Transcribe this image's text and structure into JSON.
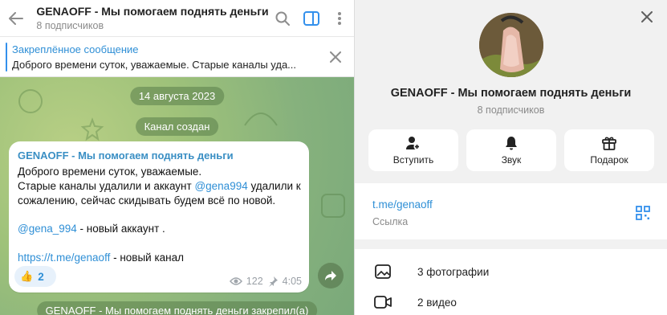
{
  "chat": {
    "title": "GENAOFF - Мы помогаем поднять деньги",
    "subtitle": "8 подписчиков",
    "pinned": {
      "title": "Закреплённое сообщение",
      "text": "Доброго времени суток, уважаемые.  Старые каналы уда..."
    },
    "date_label": "14 августа 2023",
    "created_label": "Канал создан",
    "message": {
      "author": "GENAOFF - Мы помогаем поднять деньги",
      "line1": "Доброго времени суток, уважаемые.",
      "line2_a": "Старые каналы удалили и аккаунт ",
      "line2_mention": "@gena994",
      "line2_b": " удалили к",
      "line3": "сожалению, сейчас скидывать будем всё по новой.",
      "line4_mention": "@gena_994",
      "line4_b": " - новый аккаунт .",
      "line5_link": "https://t.me/genaoff",
      "line5_b": " - новый канал",
      "reaction_emoji": "👍",
      "reaction_count": "2",
      "views": "122",
      "time": "4:05"
    },
    "bottom_service": "GENAOFF - Мы помогаем поднять деньги закрепил(а)"
  },
  "profile": {
    "title": "GENAOFF - Мы помогаем поднять деньги",
    "subtitle": "8 подписчиков",
    "actions": [
      {
        "label": "Вступить",
        "icon": "person-add-icon"
      },
      {
        "label": "Звук",
        "icon": "bell-icon"
      },
      {
        "label": "Подарок",
        "icon": "gift-icon"
      }
    ],
    "link": "t.me/genaoff",
    "link_label": "Ссылка",
    "media": [
      {
        "label": "3 фотографии",
        "icon": "photo-icon"
      },
      {
        "label": "2 видео",
        "icon": "video-icon"
      }
    ]
  },
  "colors": {
    "accent": "#3390ec",
    "link": "#2f8fd6",
    "author": "#3a8fc4"
  }
}
